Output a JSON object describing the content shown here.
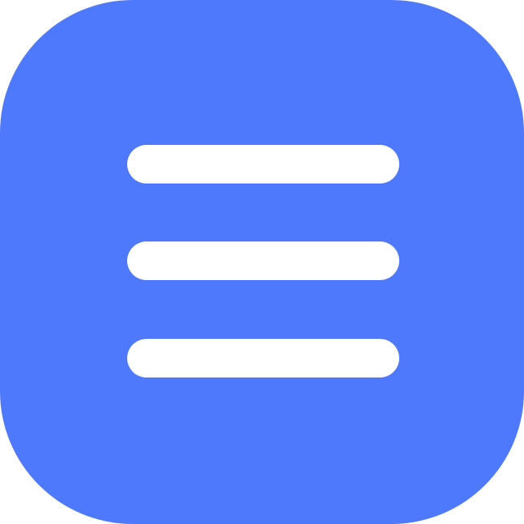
{
  "icon": {
    "name": "hamburger-menu-icon",
    "background_color": "#4f79fc",
    "bar_color": "#ffffff",
    "bars": 3
  }
}
